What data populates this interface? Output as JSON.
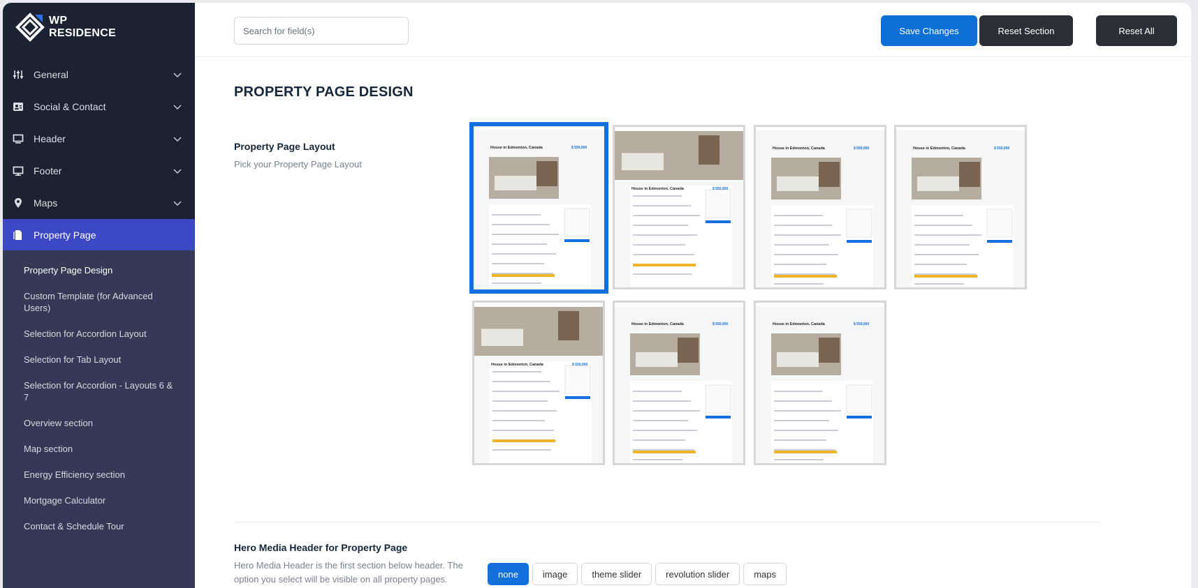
{
  "app": {
    "logo_line1": "WP",
    "logo_line2": "RESIDENCE"
  },
  "sidebar": {
    "items": [
      {
        "label": "General",
        "icon": "sliders-icon"
      },
      {
        "label": "Social & Contact",
        "icon": "contact-card-icon"
      },
      {
        "label": "Header",
        "icon": "monitor-icon"
      },
      {
        "label": "Footer",
        "icon": "desktop-icon"
      },
      {
        "label": "Maps",
        "icon": "map-pin-icon"
      },
      {
        "label": "Property Page",
        "icon": "document-icon"
      }
    ],
    "sub_items": [
      "Property Page Design",
      "Custom Template (for Advanced Users)",
      "Selection for Accordion Layout",
      "Selection for Tab Layout",
      "Selection for Accordion - Layouts 6 & 7",
      "Overview section",
      "Map section",
      "Energy Efficiency section",
      "Mortgage Calculator",
      "Contact & Schedule Tour"
    ]
  },
  "toolbar": {
    "search_placeholder": "Search for field(s)",
    "save_label": "Save Changes",
    "reset_section_label": "Reset Section",
    "reset_all_label": "Reset All"
  },
  "main": {
    "page_title": "PROPERTY PAGE DESIGN",
    "layout_option": {
      "title": "Property Page Layout",
      "description": "Pick your Property Page Layout",
      "selected_index": 0,
      "thumb_heading": "House in Edmonton, Canada",
      "thumb_price": "$ 550,000"
    },
    "hero_option": {
      "title": "Hero Media Header for Property Page",
      "description": "Hero Media Header is the first section below header. The option you select will be visible on all property pages.",
      "choices": [
        "none",
        "image",
        "theme slider",
        "revolution slider",
        "maps"
      ],
      "selected": "none"
    }
  },
  "colors": {
    "accent": "#1270de",
    "sidebar_bg": "#1b2231",
    "sidebar_active": "#3d49c4",
    "subnav_bg": "#343a55"
  }
}
